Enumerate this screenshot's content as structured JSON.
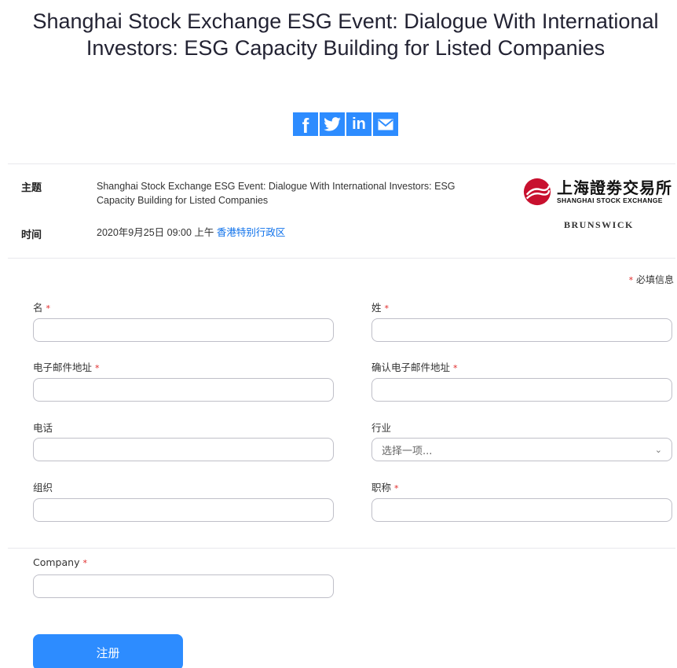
{
  "title": "Shanghai Stock Exchange ESG Event: Dialogue With International Investors: ESG Capacity Building for Listed Companies",
  "share": {
    "facebook_icon": "facebook-icon",
    "twitter_icon": "twitter-icon",
    "linkedin_icon": "linkedin-icon",
    "email_icon": "email-icon",
    "facebook_glyph": "f",
    "linkedin_glyph": "in"
  },
  "info": {
    "topic_label": "主题",
    "topic_value": "Shanghai Stock Exchange ESG Event: Dialogue With International Investors: ESG Capacity Building for Listed Companies",
    "time_label": "时间",
    "time_value": "2020年9月25日 09:00 上午",
    "timezone": "香港特别行政区"
  },
  "logos": {
    "sse_cn": "上海證劵交易所",
    "sse_en": "SHANGHAI STOCK EXCHANGE",
    "brunswick": "BRUNSWICK"
  },
  "form": {
    "required_marker": "*",
    "required_note": "必填信息",
    "first_name_label": "名",
    "last_name_label": "姓",
    "email_label": "电子邮件地址",
    "confirm_email_label": "确认电子邮件地址",
    "phone_label": "电话",
    "industry_label": "行业",
    "industry_placeholder": "选择一项...",
    "organization_label": "组织",
    "job_title_label": "职称",
    "company_label": "Company",
    "submit_label": "注册"
  },
  "colors": {
    "accent": "#2d8cff",
    "link": "#0e71eb",
    "required": "#e02828",
    "sse_red": "#c8102e"
  }
}
